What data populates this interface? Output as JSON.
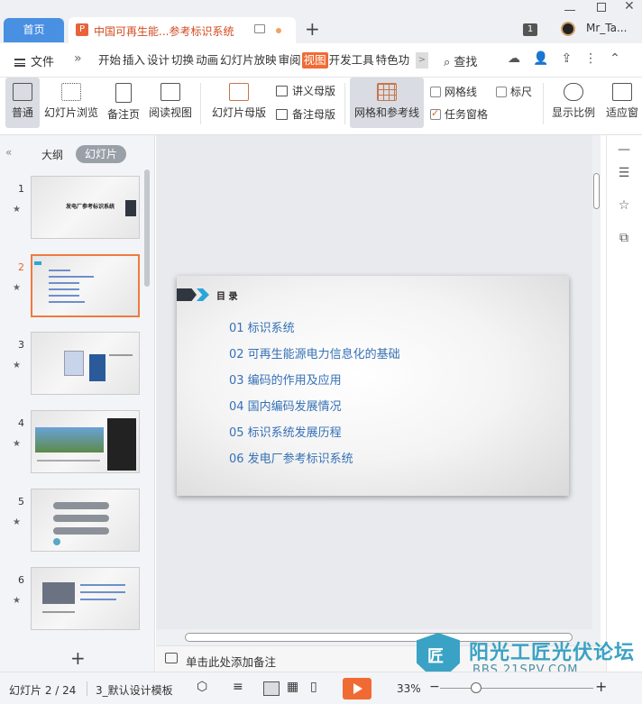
{
  "titlebar": {
    "home_tab": "首页",
    "doc_tab_title": "中国可再生能...参考标识系统",
    "doc_icon": "P",
    "new_tab": "+",
    "badge": "1",
    "user_name": "Mr_Ta..."
  },
  "menubar": {
    "file": "文件",
    "more": "»",
    "tabs": [
      "开始",
      "插入",
      "设计",
      "切换",
      "动画",
      "幻灯片放映",
      "审阅",
      "视图",
      "开发工具",
      "特色功"
    ],
    "active_tab": "视图",
    "overflow": ">",
    "search": "查找",
    "right_icons": [
      "cloud-icon",
      "share-user-icon",
      "export-icon",
      "more-icon",
      "collapse-icon"
    ]
  },
  "ribbon": {
    "normal": "普通",
    "slide_browse": "幻灯片浏览",
    "notes_page": "备注页",
    "reading_view": "阅读视图",
    "slide_master": "幻灯片母版",
    "handout_master": "讲义母版",
    "notes_master": "备注母版",
    "grid_guides": "网格和参考线",
    "gridlines": "网格线",
    "ruler": "标尺",
    "task_pane": "任务窗格",
    "zoom_ratio": "显示比例",
    "fit": "适应窗"
  },
  "left_panel": {
    "outline_tab": "大纲",
    "slides_tab": "幻灯片",
    "slides": [
      {
        "num": "1",
        "thumb_title": "发电厂参考标识系统"
      },
      {
        "num": "2",
        "thumb_title": "目录"
      },
      {
        "num": "3",
        "thumb_title": ""
      },
      {
        "num": "4",
        "thumb_title": ""
      },
      {
        "num": "5",
        "thumb_title": ""
      },
      {
        "num": "6",
        "thumb_title": ""
      }
    ],
    "star": "★",
    "add": "+"
  },
  "slide": {
    "heading": "目 录",
    "items": [
      "01 标识系统",
      "02 可再生能源电力信息化的基础",
      "03 编码的作用及应用",
      "04 国内编码发展情况",
      "05 标识系统发展历程",
      "06 发电厂参考标识系统"
    ]
  },
  "notes": {
    "placeholder": "单击此处添加备注"
  },
  "watermark": {
    "logo_char": "匠",
    "title": "阳光工匠光伏论坛",
    "url": "BBS.21SPV.COM"
  },
  "statusbar": {
    "slide_counter": "幻灯片 2 / 24",
    "template": "3_默认设计模板",
    "zoom": "33%",
    "zoom_level_percent": 33,
    "minus": "−",
    "plus": "+"
  },
  "colors": {
    "accent": "#f06b34",
    "home_tab": "#4a90e2",
    "slide_link": "#3571b5",
    "watermark": "#3aa2c4"
  }
}
